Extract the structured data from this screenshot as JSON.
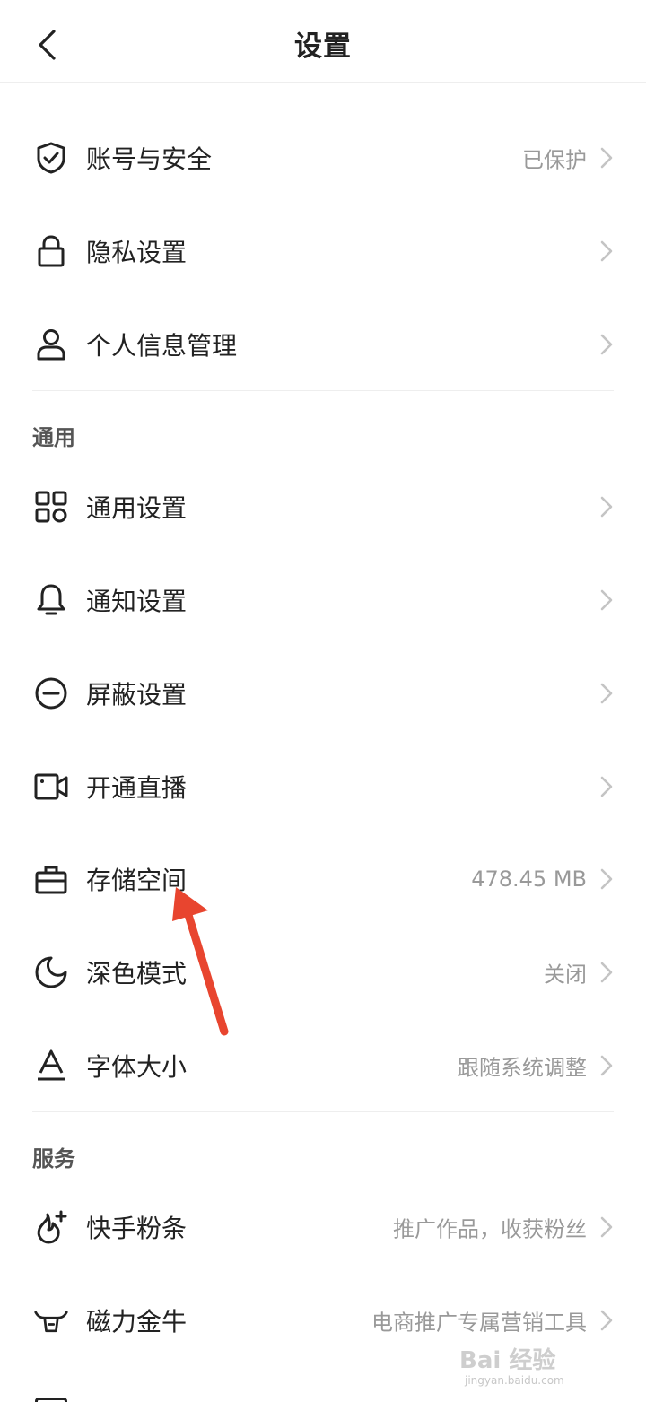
{
  "header": {
    "title": "设置"
  },
  "sections": {
    "general_title": "通用",
    "service_title": "服务"
  },
  "rows": {
    "account": {
      "label": "账号与安全",
      "value": "已保护"
    },
    "privacy": {
      "label": "隐私设置",
      "value": ""
    },
    "personal": {
      "label": "个人信息管理",
      "value": ""
    },
    "general": {
      "label": "通用设置",
      "value": ""
    },
    "notify": {
      "label": "通知设置",
      "value": ""
    },
    "block": {
      "label": "屏蔽设置",
      "value": ""
    },
    "live": {
      "label": "开通直播",
      "value": ""
    },
    "storage": {
      "label": "存储空间",
      "value": "478.45 MB"
    },
    "dark": {
      "label": "深色模式",
      "value": "关闭"
    },
    "font": {
      "label": "字体大小",
      "value": "跟随系统调整"
    },
    "fans": {
      "label": "快手粉条",
      "value": "推广作品，收获粉丝"
    },
    "cattle": {
      "label": "磁力金牛",
      "value": "电商推广专属营销工具"
    }
  },
  "watermark": {
    "brand": "Bai 经验",
    "url": "jingyan.baidu.com"
  },
  "colors": {
    "annotation_arrow": "#e8452f",
    "label": "#222222",
    "value": "#999999",
    "section": "#555555"
  }
}
